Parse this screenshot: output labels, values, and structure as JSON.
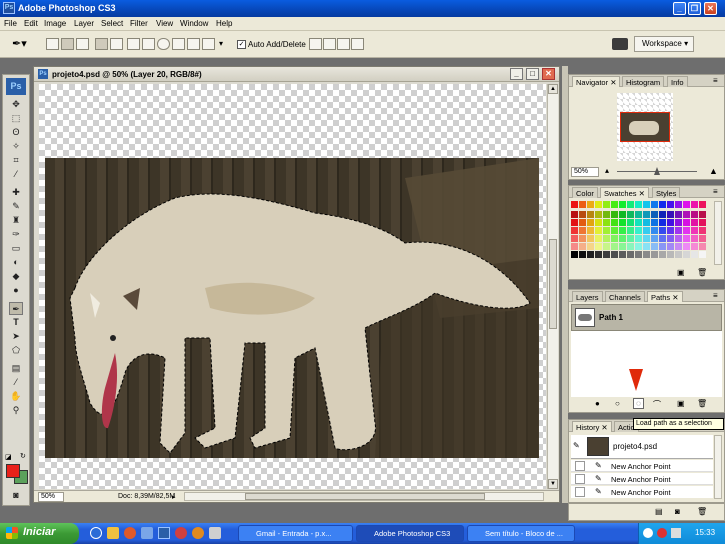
{
  "app": {
    "title": "Adobe Photoshop CS3",
    "logo": "Ps"
  },
  "menu": [
    "File",
    "Edit",
    "Image",
    "Layer",
    "Select",
    "Filter",
    "View",
    "Window",
    "Help"
  ],
  "options_bar": {
    "auto_add_delete_label": "Auto Add/Delete",
    "auto_add_delete_checked": true,
    "workspace_label": "Workspace"
  },
  "document": {
    "title": "projeto4.psd @ 50% (Layer 20, RGB/8#)",
    "zoom": "50%",
    "doc_info": "Doc: 8,39M/82,5M"
  },
  "navigator": {
    "tabs": [
      "Navigator",
      "Histogram",
      "Info"
    ],
    "zoom": "50%"
  },
  "color_panel": {
    "tabs": [
      "Color",
      "Swatches",
      "Styles"
    ]
  },
  "paths_panel": {
    "tabs": [
      "Layers",
      "Channels",
      "Paths"
    ],
    "path_name": "Path 1"
  },
  "history_panel": {
    "tabs": [
      "History",
      "Actio"
    ],
    "snapshot": "projeto4.psd",
    "steps": [
      "New Anchor Point",
      "New Anchor Point",
      "New Anchor Point"
    ]
  },
  "tooltip": "Load path as a selection",
  "taskbar": {
    "start_label": "Iniciar",
    "tasks": [
      "Gmail - Entrada - p.x...",
      "Adobe Photoshop CS3",
      "Sem título - Bloco de ..."
    ],
    "clock": "15:33"
  },
  "colors": {
    "foreground": "#e8201a",
    "background": "#5ba15b",
    "accent": "#e02a0a"
  }
}
